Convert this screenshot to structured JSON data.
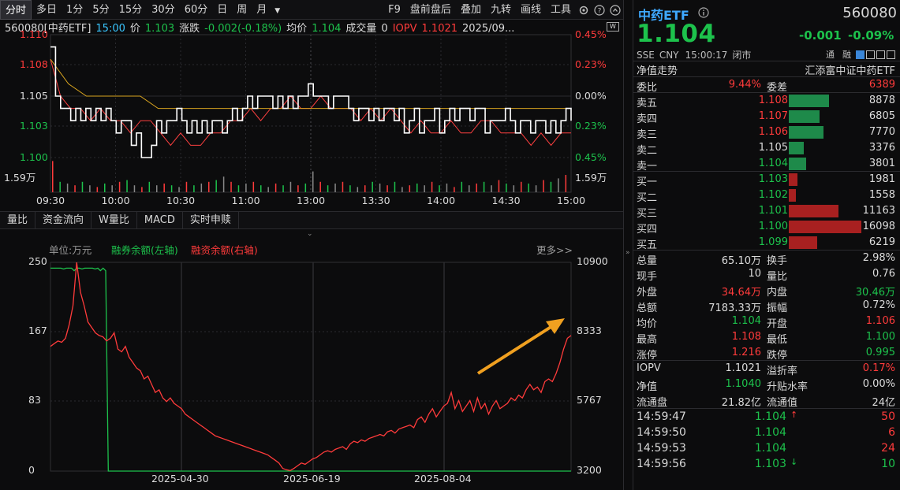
{
  "toolbar": {
    "periods": [
      "分时",
      "多日",
      "1分",
      "5分",
      "15分",
      "30分",
      "60分",
      "日",
      "周",
      "月"
    ],
    "more_icon": "dropdown-arrow",
    "right_items": [
      "F9",
      "盘前盘后",
      "叠加",
      "九转",
      "画线",
      "工具"
    ],
    "icons": [
      "gear-icon",
      "help-icon",
      "collapse-icon"
    ]
  },
  "info": {
    "code": "560080[中药ETF]",
    "time": "15:00",
    "price_label": "价",
    "price": "1.103",
    "change_label": "涨跌",
    "change": "-0.002(-0.18%)",
    "avg_label": "均价",
    "avg": "1.104",
    "vol_label": "成交量",
    "vol": "0",
    "iopv_label": "IOPV",
    "iopv": "1.1021",
    "date": "2025/09..."
  },
  "intraday": {
    "y_prices": [
      "1.110",
      "1.108",
      "1.105",
      "1.103",
      "1.100"
    ],
    "y_pcts": [
      "0.45%",
      "0.23%",
      "0.00%",
      "0.23%",
      "0.45%"
    ],
    "vol_scale_left": "1.59万",
    "vol_scale_right": "1.59万",
    "x_times": [
      "09:30",
      "10:00",
      "10:30",
      "11:00",
      "13:00",
      "13:30",
      "14:00",
      "14:30",
      "15:00"
    ],
    "price_line": [
      1.109,
      1.105,
      1.104,
      1.104,
      1.103,
      1.104,
      1.103,
      1.104,
      1.103,
      1.104,
      1.103,
      1.104,
      1.103,
      1.102,
      1.103,
      1.103,
      1.101,
      1.102,
      1.1,
      1.1,
      1.101,
      1.103,
      1.102,
      1.103,
      1.103,
      1.104,
      1.103,
      1.102,
      1.103,
      1.102,
      1.103,
      1.102,
      1.103,
      1.103,
      1.102,
      1.103,
      1.104,
      1.103,
      1.104,
      1.105,
      1.104,
      1.105,
      1.105,
      1.105,
      1.104,
      1.105,
      1.104,
      1.105,
      1.104,
      1.105,
      1.105,
      1.106,
      1.105,
      1.105,
      1.105,
      1.104,
      1.105,
      1.105,
      1.105,
      1.104,
      1.103,
      1.104,
      1.104,
      1.103,
      1.104,
      1.103,
      1.104,
      1.104,
      1.103,
      1.104,
      1.102,
      1.103,
      1.104,
      1.102,
      1.103,
      1.103,
      1.104,
      1.102,
      1.103,
      1.104,
      1.103,
      1.104,
      1.104,
      1.103,
      1.104,
      1.104,
      1.102,
      1.103,
      1.103,
      1.103,
      1.104,
      1.103,
      1.102,
      1.103,
      1.103,
      1.102,
      1.103,
      1.103,
      1.102,
      1.103,
      1.102,
      1.103,
      1.104,
      1.103
    ],
    "avg_line": [
      1.108,
      1.106,
      1.105,
      1.105,
      1.105,
      1.105,
      1.104,
      1.104,
      1.104,
      1.104,
      1.104,
      1.104,
      1.104,
      1.104,
      1.104,
      1.104,
      1.104,
      1.104,
      1.104,
      1.104,
      1.104,
      1.104,
      1.104,
      1.104,
      1.104,
      1.104,
      1.104,
      1.104,
      1.104,
      1.104
    ],
    "iopv_line": [
      1.108,
      1.105,
      1.104,
      1.104,
      1.103,
      1.104,
      1.103,
      1.103,
      1.102,
      1.103,
      1.103,
      1.102,
      1.101,
      1.102,
      1.101,
      1.101,
      1.102,
      1.102,
      1.103,
      1.103,
      1.104,
      1.103,
      1.104,
      1.104,
      1.105,
      1.104,
      1.104,
      1.105,
      1.104,
      1.104,
      1.104,
      1.103,
      1.104,
      1.103,
      1.104,
      1.103,
      1.102,
      1.103,
      1.102,
      1.102,
      1.103,
      1.102,
      1.102,
      1.103,
      1.103,
      1.102,
      1.102,
      1.102,
      1.101,
      1.102,
      1.101,
      1.102,
      1.102
    ],
    "volumes": [
      0.9,
      0.3,
      0.25,
      0.2,
      0.3,
      0.2,
      0.15,
      0.25,
      0.2,
      0.3,
      0.35,
      0.2,
      0.15,
      0.3,
      0.2,
      0.25,
      0.2,
      0.15,
      0.3,
      0.2,
      0.25,
      0.3,
      0.35,
      0.45,
      0.3,
      0.2,
      0.25,
      0.3,
      0.2,
      0.15,
      0.25,
      0.2,
      0.3,
      0.2,
      0.25,
      0.6,
      0.3,
      0.2,
      0.25,
      0.3,
      0.2,
      0.15,
      0.2,
      0.3,
      0.25,
      0.2,
      0.3,
      0.15,
      0.2,
      0.25,
      0.2,
      0.3,
      0.2,
      0.25,
      0.15,
      0.3,
      0.2,
      0.25,
      0.3,
      0.2,
      0.35,
      0.25,
      0.2,
      0.3,
      0.25,
      0.2,
      0.35,
      0.3,
      0.4,
      0.5
    ],
    "colors": {
      "price": "#ffffff",
      "avg": "#d9a520",
      "iopv": "#ff4040"
    }
  },
  "tabs": [
    "量比",
    "资金流向",
    "W量比",
    "MACD",
    "实时申赎"
  ],
  "margin_chart": {
    "unit": "单位:万元",
    "legend_left": "融券余额(左轴)",
    "legend_right": "融资余额(右轴)",
    "more": "更多>>",
    "y_left": [
      "250",
      "167",
      "83",
      "0"
    ],
    "y_right": [
      "10900",
      "8333",
      "5767",
      "3200"
    ],
    "x_dates": [
      "2025-04-30",
      "2025-06-19",
      "2025-08-04"
    ],
    "chart_data": {
      "type": "line",
      "series": [
        {
          "name": "融券余额(左轴)",
          "axis": "left",
          "color": "#1dc24c",
          "values": [
            243,
            243,
            243,
            243,
            243,
            242,
            243,
            243,
            243,
            240,
            243,
            243,
            242,
            243,
            243,
            243,
            243,
            242,
            243,
            240,
            243,
            240,
            0,
            0,
            0,
            0,
            0,
            0,
            0,
            0,
            0,
            0,
            0,
            0,
            0,
            0,
            0,
            0,
            0,
            0,
            0,
            0,
            0,
            0,
            0,
            0,
            0,
            0,
            0,
            0,
            0,
            0,
            0,
            0,
            0,
            0,
            0,
            0,
            0,
            0,
            0,
            0,
            0,
            0,
            0,
            0,
            0,
            0,
            0,
            0,
            0,
            0,
            0,
            0,
            0,
            0,
            0,
            0,
            0,
            0,
            0,
            0,
            0,
            0,
            0,
            0,
            0,
            0,
            0,
            0,
            0,
            0,
            0,
            0,
            0,
            0,
            0,
            0,
            0,
            0,
            0,
            0,
            0,
            0,
            0,
            0,
            0,
            0,
            0,
            0,
            0,
            0,
            0,
            0,
            0,
            0,
            0,
            0,
            0,
            0,
            0,
            0,
            0,
            0,
            0,
            0,
            0,
            0,
            0,
            0,
            0,
            0,
            0,
            0,
            0,
            0,
            0,
            0,
            0,
            0,
            0,
            0,
            0,
            0,
            0,
            0,
            0,
            0,
            0,
            0,
            0,
            0,
            0,
            0,
            0,
            0,
            0,
            0,
            0,
            0,
            0,
            0,
            0,
            0,
            0,
            0,
            0,
            0,
            0,
            0,
            0,
            0,
            0,
            0,
            0,
            0,
            0,
            0,
            0,
            0,
            0,
            0,
            0,
            0,
            0,
            0,
            0,
            0,
            0,
            0,
            0,
            0,
            0,
            0,
            0,
            0,
            0,
            0,
            0
          ]
        },
        {
          "name": "融资余额(右轴)",
          "axis": "right",
          "color": "#ff3b3b",
          "values": [
            7800,
            7900,
            8000,
            7950,
            8100,
            8600,
            9300,
            10900,
            9800,
            9300,
            8700,
            8500,
            8300,
            8200,
            8150,
            8000,
            8100,
            8300,
            7700,
            7600,
            7800,
            7400,
            7200,
            7000,
            6900,
            6600,
            6700,
            6400,
            6100,
            6200,
            5900,
            5767,
            5900,
            5700,
            5600,
            5500,
            5300,
            5200,
            5100,
            5000,
            4900,
            4800,
            4700,
            4600,
            4500,
            4450,
            4400,
            4350,
            4300,
            4250,
            4200,
            4150,
            4100,
            4050,
            4000,
            3950,
            3900,
            3850,
            3800,
            3700,
            3600,
            3500,
            3300,
            3250,
            3220,
            3300,
            3400,
            3500,
            3450,
            3550,
            3650,
            3700,
            3800,
            3900,
            3950,
            3900,
            4000,
            4050,
            4100,
            4000,
            4200,
            4300,
            4250,
            4350,
            4300,
            4400,
            4450,
            4500,
            4550,
            4500,
            4650,
            4700,
            4600,
            4750,
            4800,
            4850,
            4900,
            4800,
            5100,
            5200,
            5000,
            5300,
            5500,
            5200,
            5400,
            5600,
            5700,
            6100,
            5500,
            5800,
            5400,
            5600,
            5800,
            5400,
            5900,
            5500,
            5700,
            5300,
            5600,
            5800,
            5500,
            5600,
            5700,
            5900,
            5800,
            6000,
            5900,
            6200,
            6400,
            6200,
            6300,
            6100,
            6500,
            6600,
            6500,
            6800,
            7200,
            7700,
            8100,
            8200
          ]
        }
      ],
      "ylim_left": [
        0,
        250
      ],
      "ylim_right": [
        3200,
        10900
      ]
    }
  },
  "quote": {
    "name": "中药ETF",
    "code": "560080",
    "price": "1.104",
    "change": "-0.001",
    "change_pct": "-0.09%",
    "market": "SSE",
    "currency": "CNY",
    "time": "15:00:17",
    "status": "闭市",
    "tags": [
      "通",
      "融"
    ],
    "nav_trend": "净值走势",
    "fund_name": "汇添富中证中药ETF",
    "weibi_label": "委比",
    "weibi": "9.44%",
    "weicha_label": "委差",
    "weicha": "6389"
  },
  "orderbook": {
    "asks": [
      {
        "label": "卖五",
        "price": "1.108",
        "vol": "8878",
        "ratio": 0.55
      },
      {
        "label": "卖四",
        "price": "1.107",
        "vol": "6805",
        "ratio": 0.42
      },
      {
        "label": "卖三",
        "price": "1.106",
        "vol": "7770",
        "ratio": 0.48
      },
      {
        "label": "卖二",
        "price": "1.105",
        "vol": "3376",
        "ratio": 0.21
      },
      {
        "label": "卖一",
        "price": "1.104",
        "vol": "3801",
        "ratio": 0.24
      }
    ],
    "bids": [
      {
        "label": "买一",
        "price": "1.103",
        "vol": "1981",
        "ratio": 0.12
      },
      {
        "label": "买二",
        "price": "1.102",
        "vol": "1558",
        "ratio": 0.1
      },
      {
        "label": "买三",
        "price": "1.101",
        "vol": "11163",
        "ratio": 0.69
      },
      {
        "label": "买四",
        "price": "1.100",
        "vol": "16098",
        "ratio": 1.0
      },
      {
        "label": "买五",
        "price": "1.099",
        "vol": "6219",
        "ratio": 0.39
      }
    ]
  },
  "stats": [
    {
      "l1": "总量",
      "v1": "65.10万",
      "c1": "w",
      "l2": "换手",
      "v2": "2.98%",
      "c2": "w"
    },
    {
      "l1": "现手",
      "v1": "10",
      "c1": "w",
      "l2": "量比",
      "v2": "0.76",
      "c2": "w"
    },
    {
      "l1": "外盘",
      "v1": "34.64万",
      "c1": "r",
      "l2": "内盘",
      "v2": "30.46万",
      "c2": "g"
    },
    {
      "l1": "总额",
      "v1": "7183.33万",
      "c1": "w",
      "l2": "振幅",
      "v2": "0.72%",
      "c2": "w"
    },
    {
      "l1": "均价",
      "v1": "1.104",
      "c1": "g",
      "l2": "开盘",
      "v2": "1.106",
      "c2": "r"
    },
    {
      "l1": "最高",
      "v1": "1.108",
      "c1": "r",
      "l2": "最低",
      "v2": "1.100",
      "c2": "g"
    },
    {
      "l1": "涨停",
      "v1": "1.216",
      "c1": "r",
      "l2": "跌停",
      "v2": "0.995",
      "c2": "g"
    }
  ],
  "stats2": [
    {
      "l1": "IOPV",
      "v1": "1.1021",
      "c1": "w",
      "l2": "溢折率",
      "v2": "0.17%",
      "c2": "r"
    },
    {
      "l1": "净值",
      "v1": "1.1040",
      "c1": "g",
      "l2": "升贴水率",
      "v2": "0.00%",
      "c2": "w"
    },
    {
      "l1": "流通盘",
      "v1": "21.82亿",
      "c1": "w",
      "l2": "流通值",
      "v2": "24亿",
      "c2": "w"
    }
  ],
  "trades": [
    {
      "time": "14:59:47",
      "price": "1.104",
      "arrow": "up",
      "vol": "50"
    },
    {
      "time": "14:59:50",
      "price": "1.104",
      "arrow": "",
      "vol": "6"
    },
    {
      "time": "14:59:53",
      "price": "1.104",
      "arrow": "",
      "vol": "24"
    },
    {
      "time": "14:59:56",
      "price": "1.103",
      "arrow": "down",
      "vol": "10"
    }
  ]
}
